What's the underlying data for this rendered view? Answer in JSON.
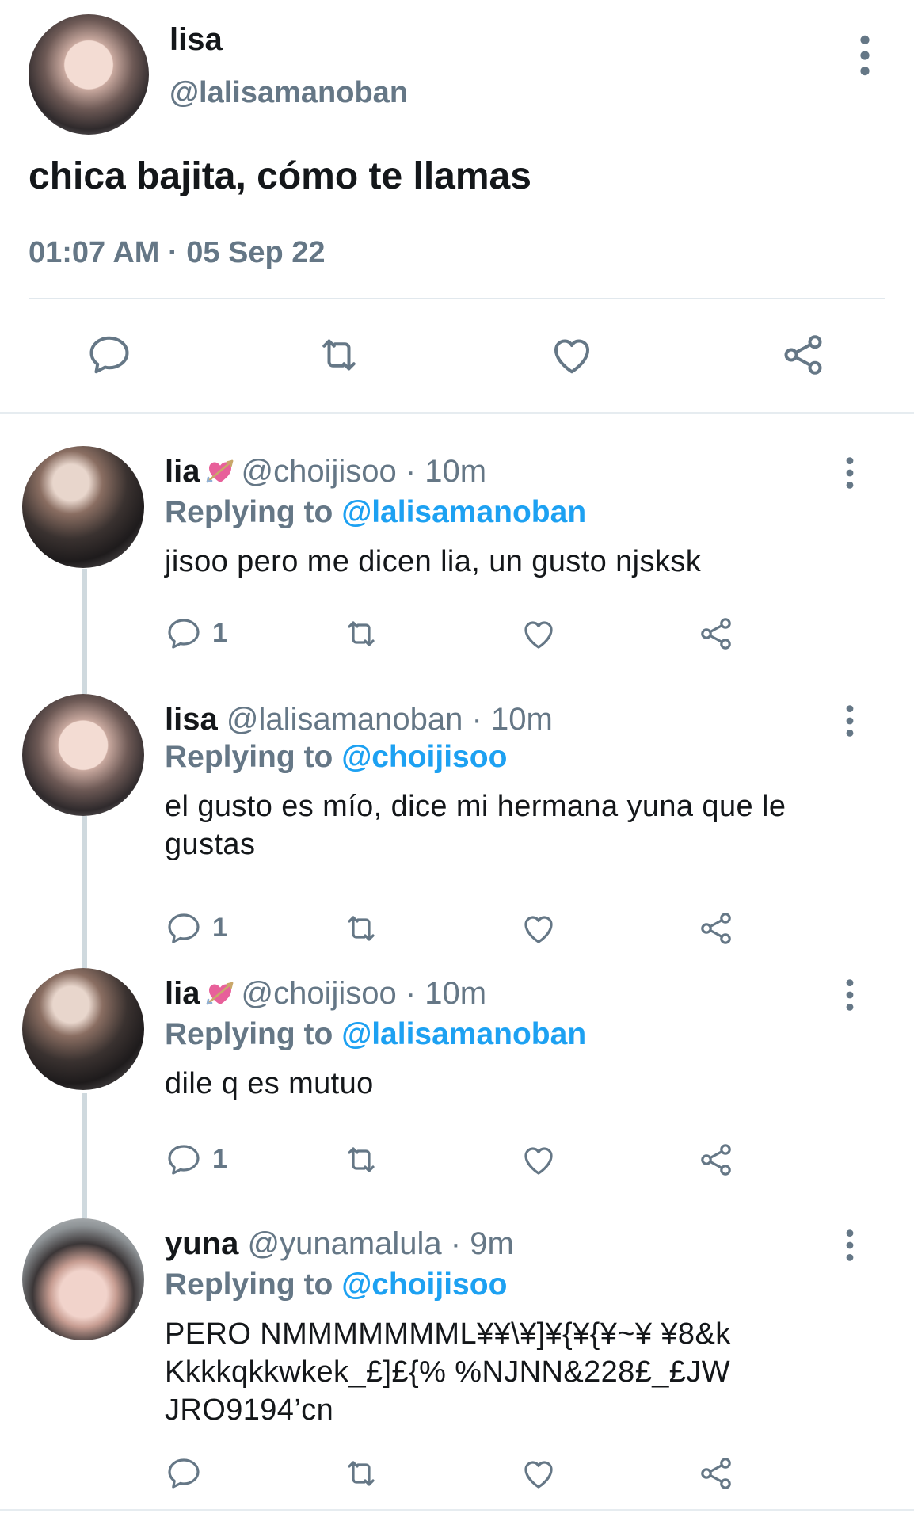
{
  "main_tweet": {
    "name": "lisa",
    "handle": "@lalisamanoban",
    "text": "chica bajita, cómo te llamas",
    "timestamp": "01:07 AM · 05 Sep 22"
  },
  "replies": [
    {
      "name": "lia",
      "emoji": "heart-with-arrow",
      "meta": "@choijisoo · 10m",
      "replying_label": "Replying to",
      "replying_to": "@lalisamanoban",
      "text": "jisoo pero me dicen lia, un gusto njsksk",
      "reply_count": "1"
    },
    {
      "name": "lisa",
      "meta": "@lalisamanoban · 10m",
      "replying_label": "Replying to",
      "replying_to": "@choijisoo",
      "text": "el gusto es mío, dice mi hermana yuna que le gustas",
      "reply_count": "1"
    },
    {
      "name": "lia",
      "emoji": "heart-with-arrow",
      "meta": "@choijisoo · 10m",
      "replying_label": "Replying to",
      "replying_to": "@lalisamanoban",
      "text": "dile q es mutuo",
      "reply_count": "1"
    },
    {
      "name": "yuna",
      "meta": "@yunamalula · 9m",
      "replying_label": "Replying to",
      "replying_to": "@choijisoo",
      "text": "PERO NMMMMMMML¥¥\\¥]¥{¥{¥~¥ ¥8&kKkkkqkkwkek_£]£{% %NJNN&228£_£JWJRO9194’cn",
      "reply_count": ""
    }
  ],
  "colors": {
    "text": "#14171a",
    "muted": "#657786",
    "link": "#1da1f2",
    "divider": "#e1e8ed",
    "icon": "#657786"
  }
}
